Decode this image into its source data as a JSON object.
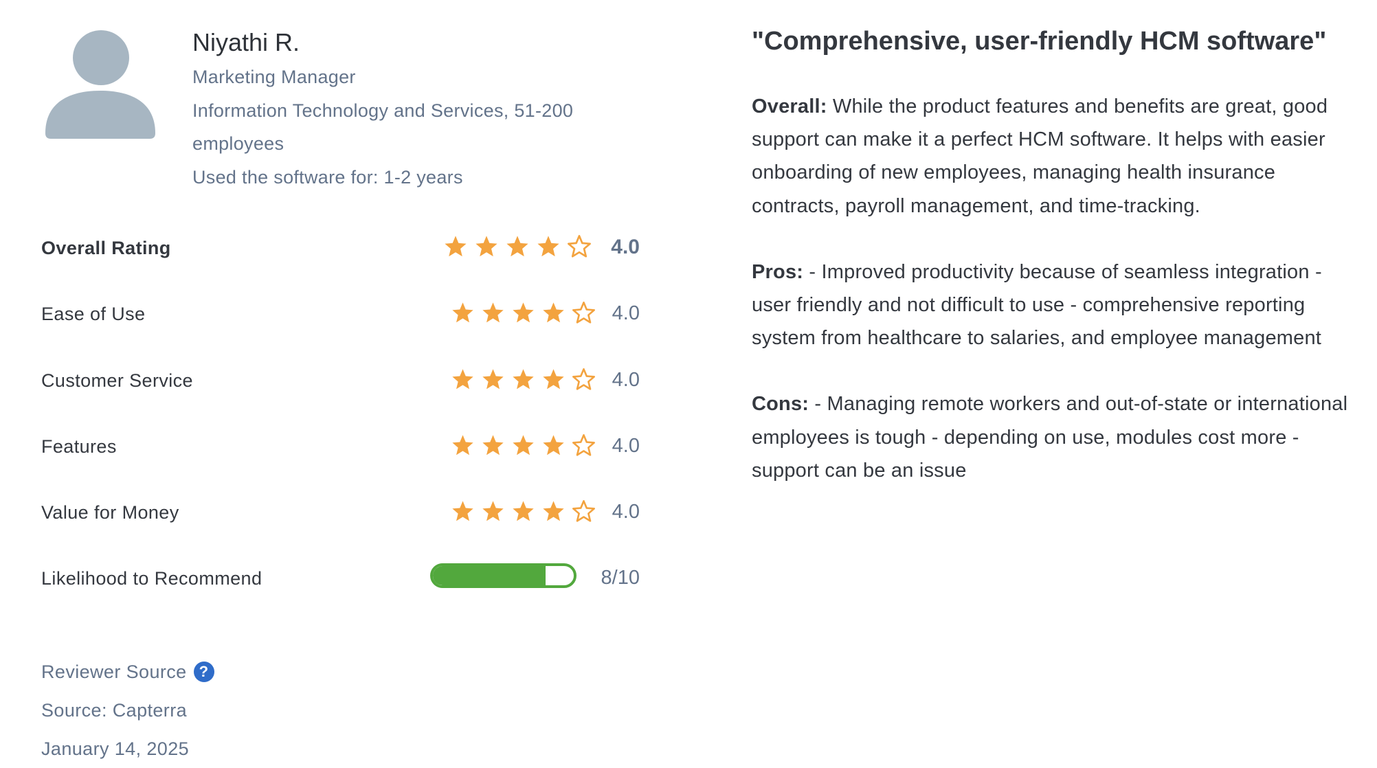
{
  "reviewer": {
    "name": "Niyathi R.",
    "job_title": "Marketing Manager",
    "industry": "Information Technology and Services, 51-200 employees",
    "usage": "Used the software for: 1-2 years",
    "avatar_icon": "user-silhouette-icon"
  },
  "ratings": {
    "overall": {
      "label": "Overall Rating",
      "stars": 4,
      "max": 5,
      "value": "4.0"
    },
    "items": [
      {
        "label": "Ease of Use",
        "stars": 4,
        "max": 5,
        "value": "4.0"
      },
      {
        "label": "Customer Service",
        "stars": 4,
        "max": 5,
        "value": "4.0"
      },
      {
        "label": "Features",
        "stars": 4,
        "max": 5,
        "value": "4.0"
      },
      {
        "label": "Value for Money",
        "stars": 4,
        "max": 5,
        "value": "4.0"
      }
    ],
    "recommend": {
      "label": "Likelihood to Recommend",
      "score": 8,
      "max": 10,
      "value": "8/10"
    }
  },
  "footer": {
    "reviewer_source_label": "Reviewer Source",
    "help_icon": "question-circle-icon",
    "help_glyph": "?",
    "source": "Source: Capterra",
    "date": "January 14, 2025"
  },
  "review": {
    "title": "\"Comprehensive, user-friendly HCM software\"",
    "overall_label": "Overall:",
    "overall_text": " While the product features and benefits are great, good support can make it a perfect HCM software. It helps with easier onboarding of new employees, managing health insurance contracts, payroll management, and time-tracking.",
    "pros_label": "Pros:",
    "pros_text": " - Improved productivity because of seamless integration - user friendly and not difficult to use - comprehensive reporting system from healthcare to salaries, and employee management",
    "cons_label": "Cons:",
    "cons_text": " - Managing remote workers and out-of-state or international employees is tough - depending on use, modules cost more - support can be an issue"
  },
  "colors": {
    "star": "#f3a33f",
    "progress": "#52a83d",
    "muted_text": "#63738a",
    "avatar": "#a7b6c2",
    "help_icon": "#2f6cc9"
  }
}
